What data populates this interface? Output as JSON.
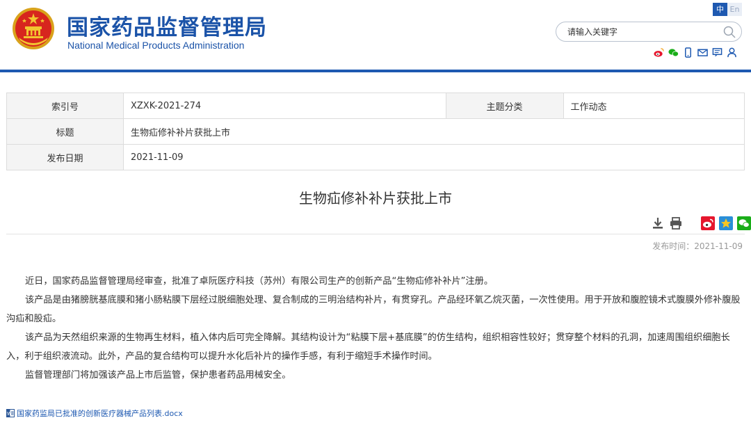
{
  "header": {
    "title_cn": "国家药品监督管理局",
    "title_en": "National Medical Products Administration",
    "lang_cn": "中",
    "lang_en": "En",
    "search_placeholder": "请输入关键字",
    "share_icons": [
      "weibo-icon",
      "wechat-icon",
      "mobile-icon",
      "email-icon",
      "message-icon",
      "user-icon"
    ]
  },
  "meta": {
    "index_label": "索引号",
    "index_value": "XZXK-2021-274",
    "category_label": "主题分类",
    "category_value": "工作动态",
    "title_label": "标题",
    "title_value": "生物疝修补补片获批上市",
    "date_label": "发布日期",
    "date_value": "2021-11-09"
  },
  "article": {
    "title": "生物疝修补补片获批上市",
    "publish_time": "发布时间：2021-11-09",
    "paragraphs": [
      "近日，国家药品监督管理局经审查，批准了卓阮医疗科技（苏州）有限公司生产的创新产品“生物疝修补补片”注册。",
      "该产品是由猪膀胱基底膜和猪小肠粘膜下层经过脱细胞处理、复合制成的三明治结构补片，有贯穿孔。产品经环氧乙烷灭菌，一次性使用。用于开放和腹腔镜术式腹膜外修补腹股沟疝和股疝。",
      "该产品为天然组织来源的生物再生材料，植入体内后可完全降解。其结构设计为“粘膜下层+基底膜”的仿生结构，组织相容性较好；贯穿整个材料的孔洞，加速周围组织细胞长入，利于组织液流动。此外，产品的复合结构可以提升水化后补片的操作手感，有利于缩短手术操作时间。",
      "监督管理部门将加强该产品上市后监管，保护患者药品用械安全。"
    ],
    "attachment": "国家药监局已批准的创新医疗器械产品列表.docx"
  },
  "colors": {
    "brand_blue": "#1e59b1",
    "weibo_red": "#e6162d",
    "wechat_green": "#1aad19",
    "qzone_yellow": "#f6c623"
  }
}
